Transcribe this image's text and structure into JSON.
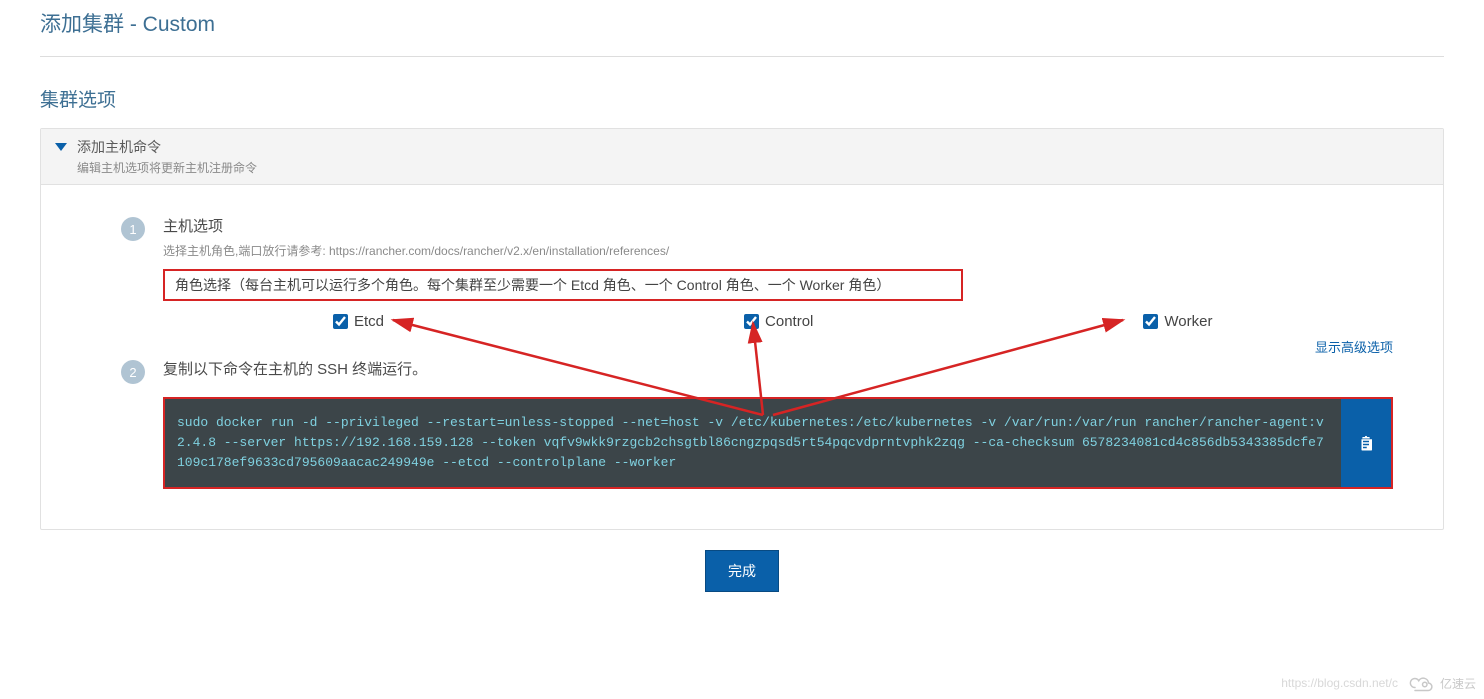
{
  "page": {
    "title": "添加集群 - Custom",
    "section_title": "集群选项"
  },
  "panel": {
    "title": "添加主机命令",
    "subtitle": "编辑主机选项将更新主机注册命令"
  },
  "step1": {
    "badge": "1",
    "title": "主机选项",
    "hint": "选择主机角色,端口放行请参考: https://rancher.com/docs/rancher/v2.x/en/installation/references/",
    "role_desc": "角色选择（每台主机可以运行多个角色。每个集群至少需要一个 Etcd 角色、一个 Control 角色、一个 Worker 角色）",
    "roles": {
      "etcd": "Etcd",
      "control": "Control",
      "worker": "Worker"
    },
    "advanced": "显示高级选项"
  },
  "step2": {
    "badge": "2",
    "title": "复制以下命令在主机的 SSH 终端运行。",
    "command": "sudo docker run -d --privileged --restart=unless-stopped --net=host -v /etc/kubernetes:/etc/kubernetes -v /var/run:/var/run rancher/rancher-agent:v2.4.8 --server https://192.168.159.128 --token vqfv9wkk9rzgcb2chsgtbl86cngzpqsd5rt54pqcvdprntvphk2zqg --ca-checksum 6578234081cd4c856db5343385dcfe7109c178ef9633cd795609aacac249949e --etcd --controlplane --worker"
  },
  "actions": {
    "done": "完成"
  },
  "watermark": {
    "csdn": "https://blog.csdn.net/c",
    "brand": "亿速云"
  }
}
